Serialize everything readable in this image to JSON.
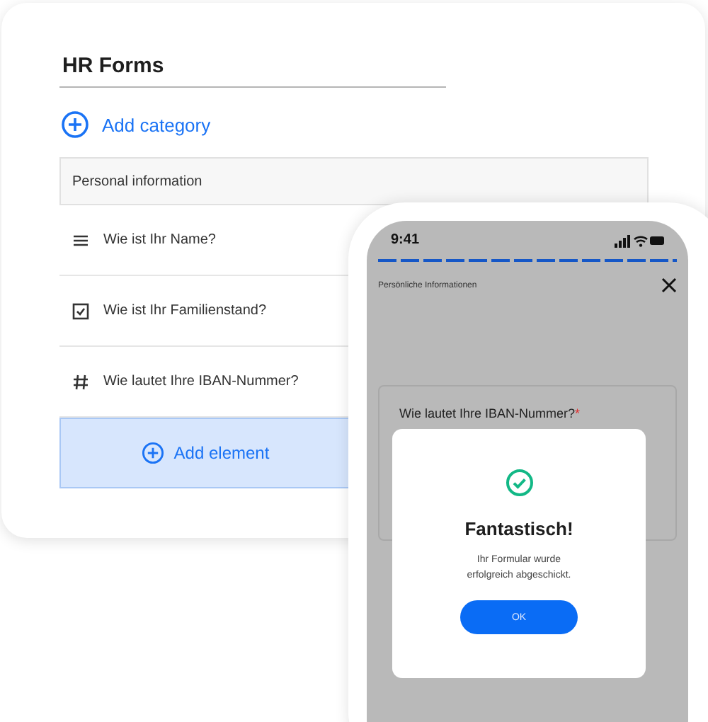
{
  "form_builder": {
    "title": "HR Forms",
    "add_category": "Add category",
    "category": "Personal information",
    "elements": [
      {
        "kind": "text",
        "label": "Wie ist Ihr Name?"
      },
      {
        "kind": "checkbox",
        "label": "Wie ist Ihr Familienstand?"
      },
      {
        "kind": "number",
        "label": "Wie lautet Ihre IBAN-Nummer?"
      }
    ],
    "add_element": "Add element"
  },
  "phone": {
    "time": "9:41",
    "progress": {
      "level": 1
    },
    "header": "Persönliche Informationen",
    "question": {
      "label": "Wie lautet Ihre IBAN-Nummer?",
      "required": true,
      "required_mark": "*"
    },
    "dialog": {
      "title": "Fantastisch!",
      "message": "Ihr Formular wurde erfolgreich abgeschickt.",
      "button": "OK"
    }
  }
}
